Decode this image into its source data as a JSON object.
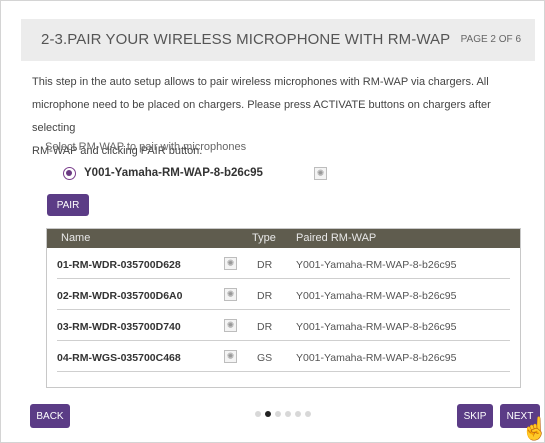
{
  "header": {
    "title": "2-3.PAIR YOUR WIRELESS MICROPHONE WITH RM-WAP",
    "page": "PAGE 2 OF 6"
  },
  "description": {
    "lines": [
      "This step in the auto setup allows to pair wireless microphones with RM-WAP via chargers. All",
      "microphone need to be placed on chargers. Please press ACTIVATE buttons on chargers after selecting",
      "RM-WAP and clicking PAIR button."
    ]
  },
  "select": {
    "label": "Select RM-WAP to pair with microphones",
    "option": "Y001-Yamaha-RM-WAP-8-b26c95",
    "option_icon": "identify-icon"
  },
  "pair_button": "PAIR",
  "table": {
    "headers": {
      "name": "Name",
      "type": "Type",
      "paired": "Paired RM-WAP"
    },
    "rows": [
      {
        "name": "01-RM-WDR-035700D628",
        "type": "DR",
        "paired": "Y001-Yamaha-RM-WAP-8-b26c95"
      },
      {
        "name": "02-RM-WDR-035700D6A0",
        "type": "DR",
        "paired": "Y001-Yamaha-RM-WAP-8-b26c95"
      },
      {
        "name": "03-RM-WDR-035700D740",
        "type": "DR",
        "paired": "Y001-Yamaha-RM-WAP-8-b26c95"
      },
      {
        "name": "04-RM-WGS-035700C468",
        "type": "GS",
        "paired": "Y001-Yamaha-RM-WAP-8-b26c95"
      }
    ]
  },
  "footer": {
    "back": "BACK",
    "skip": "SKIP",
    "next": "NEXT",
    "pagination": {
      "total": 6,
      "current": 2
    }
  },
  "colors": {
    "accent": "#5b3c86",
    "table_header": "#5f5c4e",
    "header_bg": "#ececec"
  }
}
